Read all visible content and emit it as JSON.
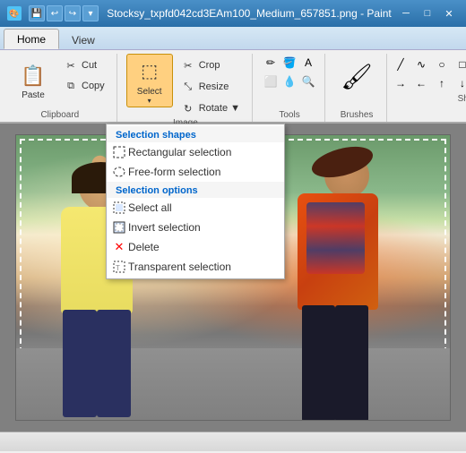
{
  "titleBar": {
    "title": "Stocksy_txpfd042cd3EAm100_Medium_657851.png - Paint",
    "minBtn": "─",
    "maxBtn": "□",
    "closeBtn": "✕"
  },
  "ribbonTabs": [
    {
      "label": "Home",
      "active": true
    },
    {
      "label": "View",
      "active": false
    }
  ],
  "clipboard": {
    "groupLabel": "Clipboard",
    "pasteLabel": "Paste",
    "cutLabel": "Cut",
    "copyLabel": "Copy"
  },
  "image": {
    "groupLabel": "Image",
    "selectLabel": "Select",
    "cropLabel": "Crop",
    "resizeLabel": "Resize",
    "rotateLabel": "Rotate ▼"
  },
  "tools": {
    "groupLabel": "Tools"
  },
  "brushes": {
    "groupLabel": "Brushes",
    "label": "Brushes"
  },
  "shapes": {
    "groupLabel": "Shapes"
  },
  "dropdown": {
    "selectionShapesHeader": "Selection shapes",
    "selectionOptionsHeader": "Selection options",
    "items": [
      {
        "label": "Rectangular selection",
        "icon": "rect-select"
      },
      {
        "label": "Free-form selection",
        "icon": "freeform-select"
      },
      {
        "label": "Select all",
        "icon": "select-all"
      },
      {
        "label": "Invert selection",
        "icon": "invert-select"
      },
      {
        "label": "Delete",
        "icon": "delete"
      },
      {
        "label": "Transparent selection",
        "icon": "transparent-select"
      }
    ]
  },
  "statusBar": {
    "dimensions": "",
    "zoom": ""
  }
}
